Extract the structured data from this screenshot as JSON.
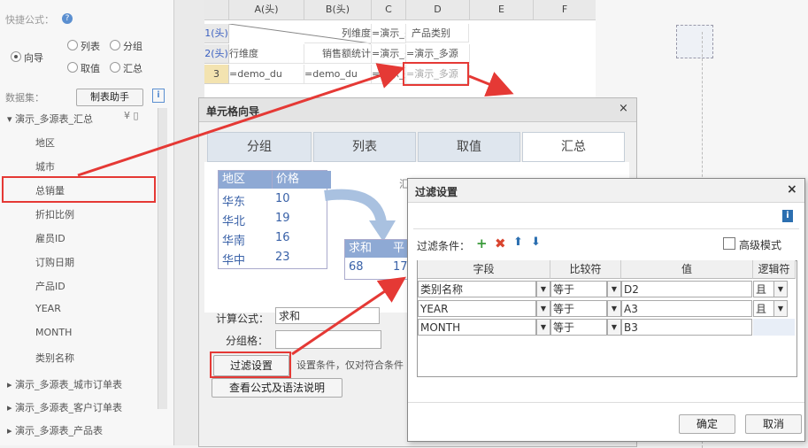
{
  "left_panel": {
    "quick_formula_label": "快捷公式：",
    "wizard_option": "向导",
    "options": [
      "列表",
      "分组",
      "取值",
      "汇总"
    ],
    "dataset_label": "数据集：",
    "table_helper_btn": "制表助手",
    "tree": {
      "root": "演示_多源表_汇总",
      "fields": [
        "地区",
        "城市",
        "总销量",
        "折扣比例",
        "雇员ID",
        "订购日期",
        "产品ID",
        "YEAR",
        "MONTH",
        "类别名称"
      ],
      "groups": [
        "演示_多源表_城市订单表",
        "演示_多源表_客户订单表",
        "演示_多源表_产品表"
      ]
    }
  },
  "sheet": {
    "col_headers": [
      "A(头)",
      "B(头)",
      "C",
      "D",
      "E",
      "F"
    ],
    "row_headers": [
      "1(头)",
      "2(头)",
      "3"
    ],
    "rows": [
      [
        "",
        "列维度",
        "=演示_多源",
        "产品类别",
        "",
        ""
      ],
      [
        "行维度",
        "销售额统计",
        "=演示_多源",
        "=演示_多源",
        "",
        ""
      ],
      [
        "=demo_du",
        "=demo_du",
        "=演示_多源",
        "=演示_多源",
        "",
        ""
      ]
    ]
  },
  "wizard": {
    "title": "单元格向导",
    "tabs": [
      "分组",
      "列表",
      "取值",
      "汇总"
    ],
    "active_tab": 3,
    "sample_table": {
      "headers": [
        "地区",
        "价格"
      ],
      "rows": [
        [
          "华东",
          "10"
        ],
        [
          "华北",
          "19"
        ],
        [
          "华南",
          "16"
        ],
        [
          "华中",
          "23"
        ]
      ]
    },
    "result_table": {
      "headers": [
        "求和",
        "平"
      ],
      "values": [
        "68",
        "17"
      ]
    },
    "calc_formula_label": "计算公式：",
    "calc_formula_value": "求和",
    "group_cell_label": "分组格：",
    "filter_button": "过滤设置",
    "filter_hint": "设置条件，仅对符合条件",
    "view_formula_button": "查看公式及语法说明",
    "partial_char": "汇"
  },
  "filter_dialog": {
    "title": "过滤设置",
    "conditions_label": "过滤条件：",
    "advanced_label": "高级模式",
    "columns": [
      "字段",
      "比较符",
      "值",
      "逻辑符"
    ],
    "rows": [
      {
        "field": "类别名称",
        "op": "等于",
        "value": "D2",
        "logic": "且"
      },
      {
        "field": "YEAR",
        "op": "等于",
        "value": "A3",
        "logic": "且"
      },
      {
        "field": "MONTH",
        "op": "等于",
        "value": "B3",
        "logic": ""
      }
    ],
    "ok_button": "确定",
    "cancel_button": "取消"
  },
  "colors": {
    "accent_red": "#e53935",
    "tab_bg": "#dfe6ee",
    "link_blue": "#2c6fb0"
  }
}
